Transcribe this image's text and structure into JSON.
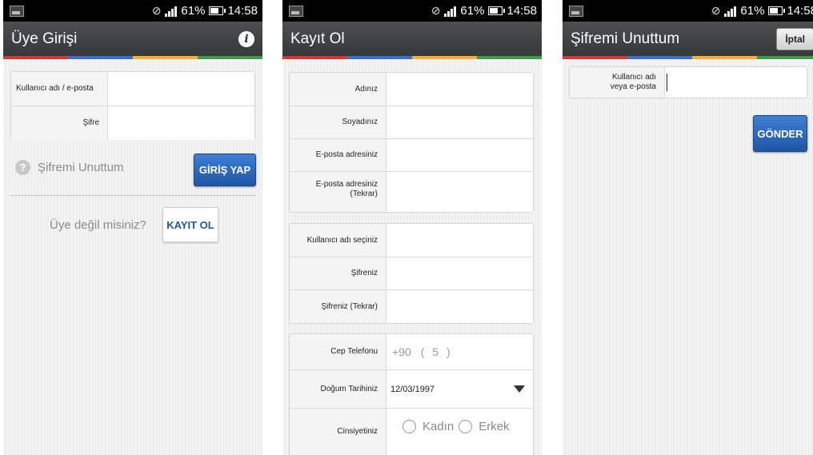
{
  "status_bar": {
    "battery": "61%",
    "time": "14:58"
  },
  "colors": {
    "accent_blue": "#1f56a6",
    "action_bar": "#3c3f41"
  },
  "login": {
    "title": "Üye Girişi",
    "info_icon": "info-icon",
    "username_label": "Kullanıcı adı / e-posta",
    "password_label": "Şifre",
    "forgot_icon": "question-circle-icon",
    "forgot_label": "Şifremi Unuttum",
    "login_button": "GİRİŞ YAP",
    "not_member_text": "Üye değil misiniz?",
    "register_button": "KAYIT OL"
  },
  "register": {
    "title": "Kayıt Ol",
    "group1": [
      "Adınız",
      "Soyadınız",
      "E-posta adresiniz",
      "E-posta adresiniz\n(Tekrar)"
    ],
    "group2": [
      "Kullanıcı adı seçiniz",
      "Şifreniz",
      "Şifreniz (Tekrar)"
    ],
    "phone_label": "Cep Telefonu",
    "phone_prefix": "+90",
    "phone_area": "( 5 )",
    "birth_label": "Doğum Tarihiniz",
    "birth_value": "12/03/1997",
    "gender_label": "Cinsiyetiniz",
    "gender_options": [
      "Kadın",
      "Erkek"
    ]
  },
  "forgot": {
    "title": "Şifremi Unuttum",
    "cancel_button": "İptal",
    "field_label": "Kullanıcı adı\nveya e-posta",
    "send_button": "GÖNDER"
  }
}
